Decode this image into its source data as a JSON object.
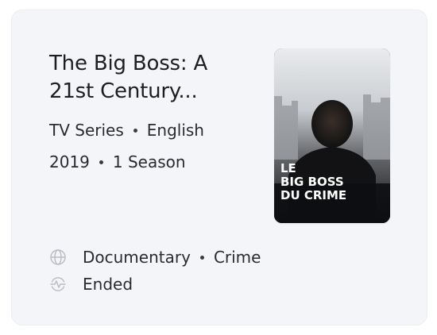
{
  "card": {
    "title": "The Big Boss: A 21st Century...",
    "type": "TV Series",
    "language": "English",
    "year": "2019",
    "seasons": "1 Season",
    "poster": {
      "text_line1": "LE",
      "text_line2": "BIG BOSS",
      "text_line3": "DU CRIME"
    },
    "genres": [
      "Documentary",
      "Crime"
    ],
    "status": "Ended",
    "icons": {
      "genre": "globe-icon",
      "status": "pulse-icon"
    },
    "colors": {
      "card_bg": "#f4f5f9",
      "text": "#1f2024",
      "icon": "#b9bbc2"
    }
  }
}
